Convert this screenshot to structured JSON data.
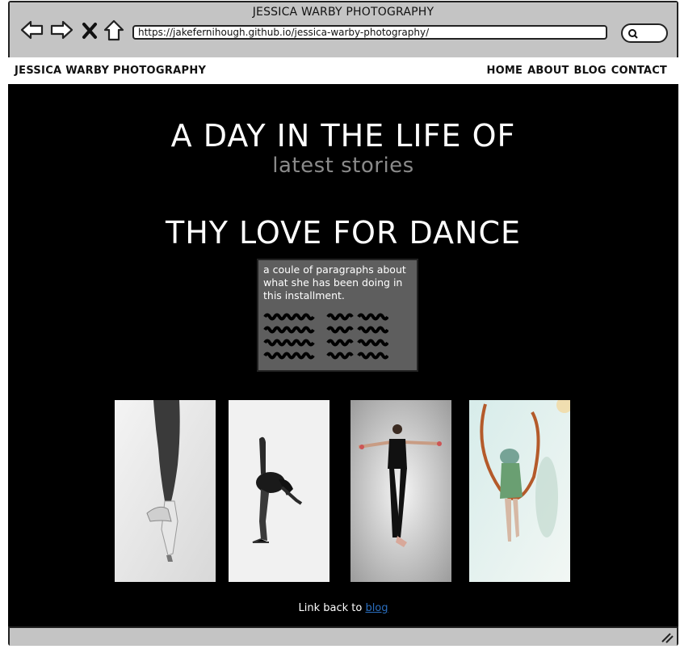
{
  "window": {
    "title": "JESSICA WARBY PHOTOGRAPHY",
    "url": "https://jakefernihough.github.io/jessica-warby-photography/"
  },
  "site": {
    "brand": "JESSICA WARBY PHOTOGRAPHY",
    "nav": [
      "HOME",
      "ABOUT",
      "BLOG",
      "CONTACT"
    ]
  },
  "main": {
    "heading": "A DAY IN THE LIFE OF",
    "subheading": "latest stories",
    "story_title": "THY LOVE FOR DANCE",
    "story_text": "a coule of paragraphs about what she has been doing in this installment.",
    "photos": [
      {
        "name": "pointe-shoe-photo"
      },
      {
        "name": "dancer-bend-photo"
      },
      {
        "name": "dancer-arms-out-photo"
      },
      {
        "name": "dancer-ribbon-photo"
      }
    ],
    "footer_text": "Link back to ",
    "footer_link": "blog"
  },
  "colors": {
    "frame": "#c4c4c4",
    "content_bg": "#000000",
    "subheading": "#8a8a8a",
    "textbox_bg": "#5e5e5e",
    "link": "#2a6ebf"
  }
}
